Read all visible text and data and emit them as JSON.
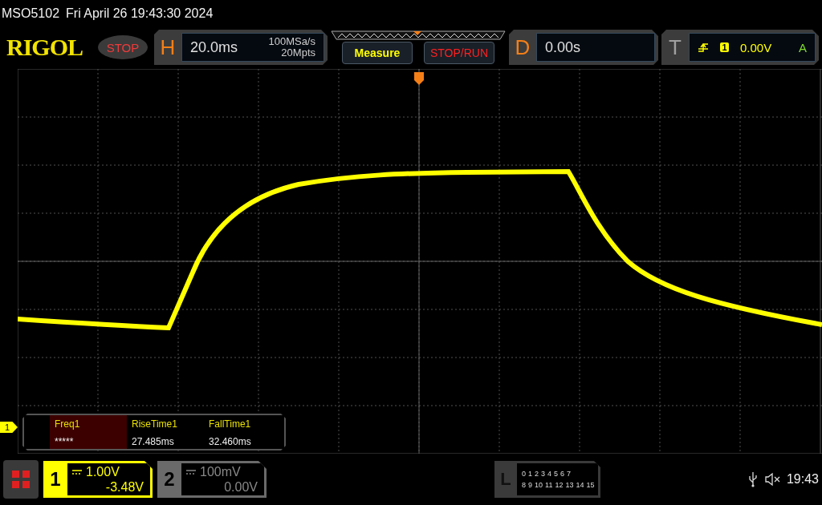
{
  "status_line": {
    "model": "MSO5102",
    "datetime": "Fri April 26 19:43:30 2024"
  },
  "logo": "RIGOL",
  "run_state": "STOP",
  "horizontal": {
    "label": "H",
    "timebase": "20.0ms",
    "sample_rate": "100MSa/s",
    "memory_depth": "20Mpts"
  },
  "buttons": [
    {
      "label": "Measure",
      "kind": "measure"
    },
    {
      "label": "STOP/RUN",
      "kind": "run_control"
    }
  ],
  "delay": {
    "label": "D",
    "value": "0.00s"
  },
  "trigger": {
    "label": "T",
    "source": "1",
    "trigger_level": "0.00V",
    "mode": "A"
  },
  "channel_marker": "1",
  "measurements": [
    {
      "name": "Freq1",
      "value": "*****",
      "selected": true
    },
    {
      "name": "RiseTime1",
      "value": "27.485ms",
      "selected": false
    },
    {
      "name": "FallTime1",
      "value": "32.460ms",
      "selected": false
    }
  ],
  "channels": [
    {
      "number": "1",
      "scale": "1.00V",
      "offset": "-3.48V",
      "selected": true
    },
    {
      "number": "2",
      "scale": "100mV",
      "offset": "0.00V",
      "selected": false
    }
  ],
  "logic": {
    "label": "L",
    "row_1": [
      "0",
      "1",
      "2",
      "3",
      "4",
      "5",
      "6",
      "7"
    ],
    "row_2": [
      "8",
      "9",
      "10",
      "11",
      "12",
      "13",
      "14",
      "15"
    ]
  },
  "clock": "19:43"
}
